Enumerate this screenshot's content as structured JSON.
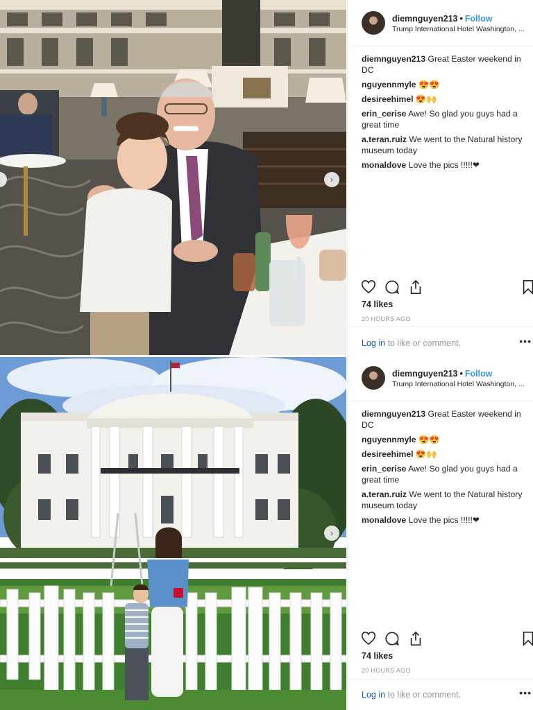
{
  "posts": [
    {
      "username": "diemnguyen213",
      "separator": "•",
      "follow_label": "Follow",
      "location": "Trump International Hotel Washington, ...",
      "caption_user": "diemnguyen213",
      "caption_text": "Great Easter weekend in DC",
      "comments": [
        {
          "user": "nguyennmyle",
          "text": "😍😍"
        },
        {
          "user": "desireehimel",
          "text": "😍🙌"
        },
        {
          "user": "erin_cerise",
          "text": "Awe! So glad you guys had a great time"
        },
        {
          "user": "a.teran.ruiz",
          "text": "We went to the Natural history museum today"
        },
        {
          "user": "monaldove",
          "text": "Love the pics !!!!!❤"
        }
      ],
      "likes": "74 likes",
      "time": "20 HOURS AGO",
      "login_link": "Log in",
      "login_text": " to like or comment.",
      "more_icon": "•••"
    },
    {
      "username": "diemnguyen213",
      "separator": "•",
      "follow_label": "Follow",
      "location": "Trump International Hotel Washington, ...",
      "caption_user": "diemnguyen213",
      "caption_text": "Great Easter weekend in DC",
      "comments": [
        {
          "user": "nguyennmyle",
          "text": "😍😍"
        },
        {
          "user": "desireehimel",
          "text": "😍🙌"
        },
        {
          "user": "erin_cerise",
          "text": "Awe! So glad you guys had a great time"
        },
        {
          "user": "a.teran.ruiz",
          "text": "We went to the Natural history museum today"
        },
        {
          "user": "monaldove",
          "text": "Love the pics !!!!!❤"
        }
      ],
      "likes": "74 likes",
      "time": "20 HOURS AGO",
      "login_link": "Log in",
      "login_text": " to like or comment.",
      "more_icon": "•••"
    }
  ],
  "icons": {
    "like": "heart-icon",
    "comment": "comment-icon",
    "share": "share-icon",
    "save": "bookmark-icon",
    "next": "chevron-right-icon"
  },
  "colors": {
    "follow": "#3897f0",
    "muted": "#999999",
    "text": "#262626"
  }
}
